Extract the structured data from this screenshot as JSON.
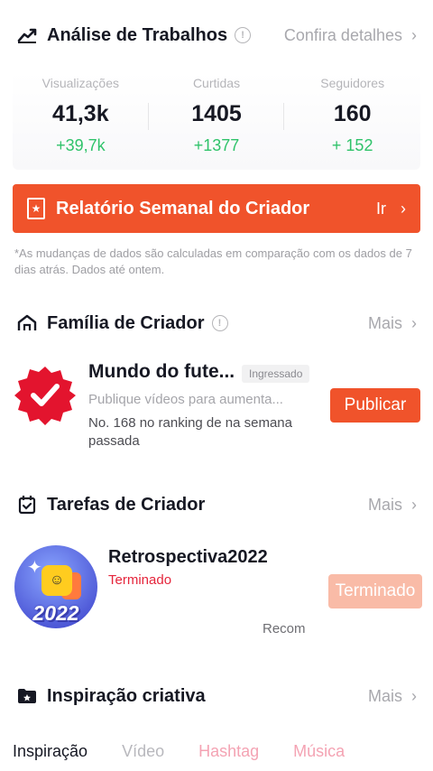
{
  "analysis": {
    "title": "Análise de Trabalhos",
    "info_icon": "info-icon",
    "details_label": "Confira detalhes",
    "stats": [
      {
        "label": "Visualizações",
        "value": "41,3k",
        "delta": "+39,7k"
      },
      {
        "label": "Curtidas",
        "value": "1405",
        "delta": "+1377"
      },
      {
        "label": "Seguidores",
        "value": "160",
        "delta": "+ 152"
      }
    ],
    "delta_color": "#2fc36a"
  },
  "report": {
    "label": "Relatório Semanal do Criador",
    "go_label": "Ir",
    "color": "#f0532b"
  },
  "note": "*As mudanças de dados são calculadas em comparação com os dados de 7 dias atrás. Dados até ontem.",
  "family": {
    "title": "Família de Criador",
    "more_label": "Mais",
    "name": "Mundo do fute...",
    "tag": "Ingressado",
    "subtitle": "Publique vídeos para aumenta...",
    "rank": "No. 168 no ranking de na semana passada",
    "button": "Publicar"
  },
  "tasks": {
    "title": "Tarefas de Criador",
    "more_label": "Mais",
    "name": "Retrospectiva2022",
    "status": "Terminado",
    "status_color": "#e5243b",
    "button": "Terminado",
    "avatar_year": "2022",
    "recom": "Recom"
  },
  "inspiration": {
    "title": "Inspiração criativa",
    "more_label": "Mais",
    "tabs": [
      "Inspiração",
      "Vídeo",
      "Hashtag",
      "Música"
    ]
  }
}
